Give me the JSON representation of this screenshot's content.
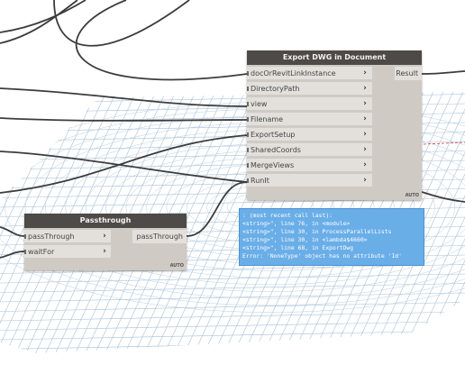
{
  "export_node": {
    "title": "Export DWG in Document",
    "inputs": [
      "docOrRevitLinkInstance",
      "DirectoryPath",
      "view",
      "Filename",
      "ExportSetup",
      "SharedCoords",
      "MergeViews",
      "RunIt"
    ],
    "output": "Result",
    "lacing": "AUTO"
  },
  "passthrough_node": {
    "title": "Passthrough",
    "inputs": [
      "passThrough",
      "waitFor"
    ],
    "output": "passThrough",
    "lacing": "AUTO"
  },
  "error": {
    "lines": [
      ": (most recent call last):",
      "<string>\", line 76, in <module>",
      "<string>\", line 30, in ProcessParallelLists",
      "<string>\", line 30, in <lambda$4660>",
      "<string>\", line 68, in ExportDwg",
      "Error: 'NoneType' object has no attribute 'Id'"
    ]
  },
  "colors": {
    "node_header": "#4d4a47",
    "node_body": "#cfcac4",
    "wire": "#3c3c3c",
    "error_bg": "#6aaee8",
    "floor_grid": "#a9c1d6",
    "floor_red_line": "#d23c3c"
  }
}
